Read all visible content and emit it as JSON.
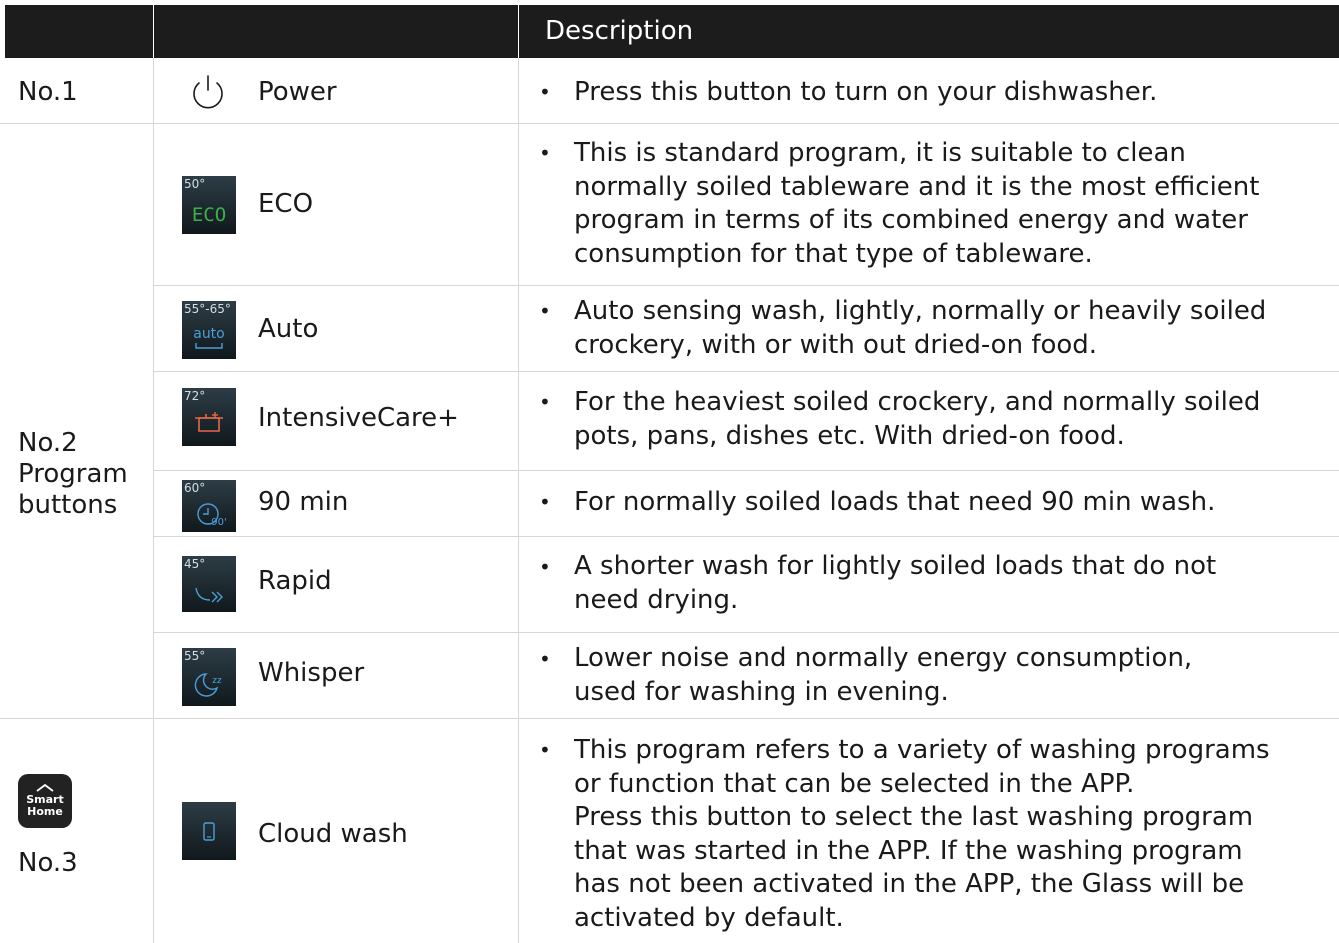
{
  "header": {
    "title": "Description"
  },
  "rows": {
    "power": {
      "number": "No.1",
      "name": "Power",
      "icon": "power-icon",
      "description": [
        "Press this button to turn on your dishwasher."
      ]
    },
    "program_group_label": [
      "No.2",
      "Program",
      "buttons"
    ],
    "eco": {
      "temp": "50°",
      "icon_text": "ECO",
      "name": "ECO",
      "description": [
        "This is standard program, it is suitable to clean",
        "normally soiled tableware and it is the most efficient",
        "program in terms of its combined energy and water",
        "consumption for that type of tableware."
      ]
    },
    "auto": {
      "temp": "55°-65°",
      "icon_text": "auto",
      "name": "Auto",
      "description": [
        "Auto sensing wash, lightly, normally or heavily soiled",
        "crockery, with or with out dried-on food."
      ]
    },
    "intensive": {
      "temp": "72°",
      "name": "IntensiveCare+",
      "description": [
        "For the heaviest soiled crockery, and normally soiled",
        "pots, pans, dishes etc. With dried-on food."
      ]
    },
    "min90": {
      "temp": "60°",
      "icon_text": "90'",
      "name": "90 min",
      "description": [
        "For normally soiled loads that need 90 min wash."
      ]
    },
    "rapid": {
      "temp": "45°",
      "name": "Rapid",
      "description": [
        "A shorter wash for lightly soiled loads that do not",
        "need drying."
      ]
    },
    "whisper": {
      "temp": "55°",
      "icon_text": "zz",
      "name": "Whisper",
      "description": [
        "Lower noise and normally energy consumption,",
        "used for washing in evening."
      ]
    },
    "cloud": {
      "badge": [
        "Smart",
        "Home"
      ],
      "number": "No.3",
      "name": "Cloud wash",
      "description": [
        "This program refers to a variety of washing programs",
        "or function that can be selected in the APP.",
        "Press this button to select the last washing program",
        "that was started in the APP. If the washing program",
        "has not been activated in the APP, the Glass will be",
        "activated by default."
      ]
    }
  },
  "colors": {
    "header_bg": "#1c1c1c",
    "grid_line": "#d6d6d6",
    "eco_green": "#3fae49",
    "auto_blue": "#4a9fd8",
    "intensive_orange": "#e4684a"
  }
}
